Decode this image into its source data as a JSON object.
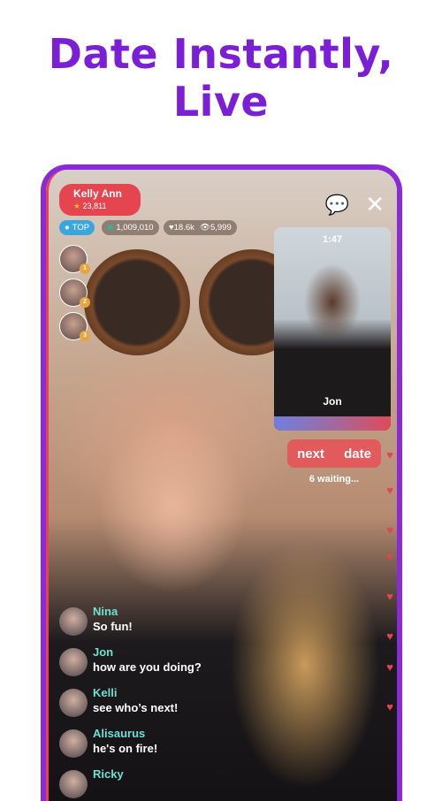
{
  "headline": {
    "line1": "Date Instantly,",
    "line2": "Live"
  },
  "host": {
    "name": "Kelly Ann",
    "score": "23,811"
  },
  "stats": {
    "badge": "TOP",
    "gems": "1,009,010",
    "likes": "18.6k",
    "viewers": "5,999"
  },
  "viewer_badges": [
    "1",
    "2",
    "3"
  ],
  "pip": {
    "timer": "1:47",
    "name": "Jon"
  },
  "next_date": {
    "label_left": "next",
    "label_right": "date",
    "waiting": "6 waiting..."
  },
  "chat": [
    {
      "user": "Nina",
      "text": "So fun!"
    },
    {
      "user": "Jon",
      "text": "how are you doing?"
    },
    {
      "user": "Kelli",
      "text": "see who’s next!"
    },
    {
      "user": "Alisaurus",
      "text": "he's on fire!"
    },
    {
      "user": "Ricky",
      "text": ""
    }
  ],
  "colors": {
    "brand": "#7b1fd6",
    "accent": "#e5454f",
    "chat_user": "#6fe0cf"
  }
}
